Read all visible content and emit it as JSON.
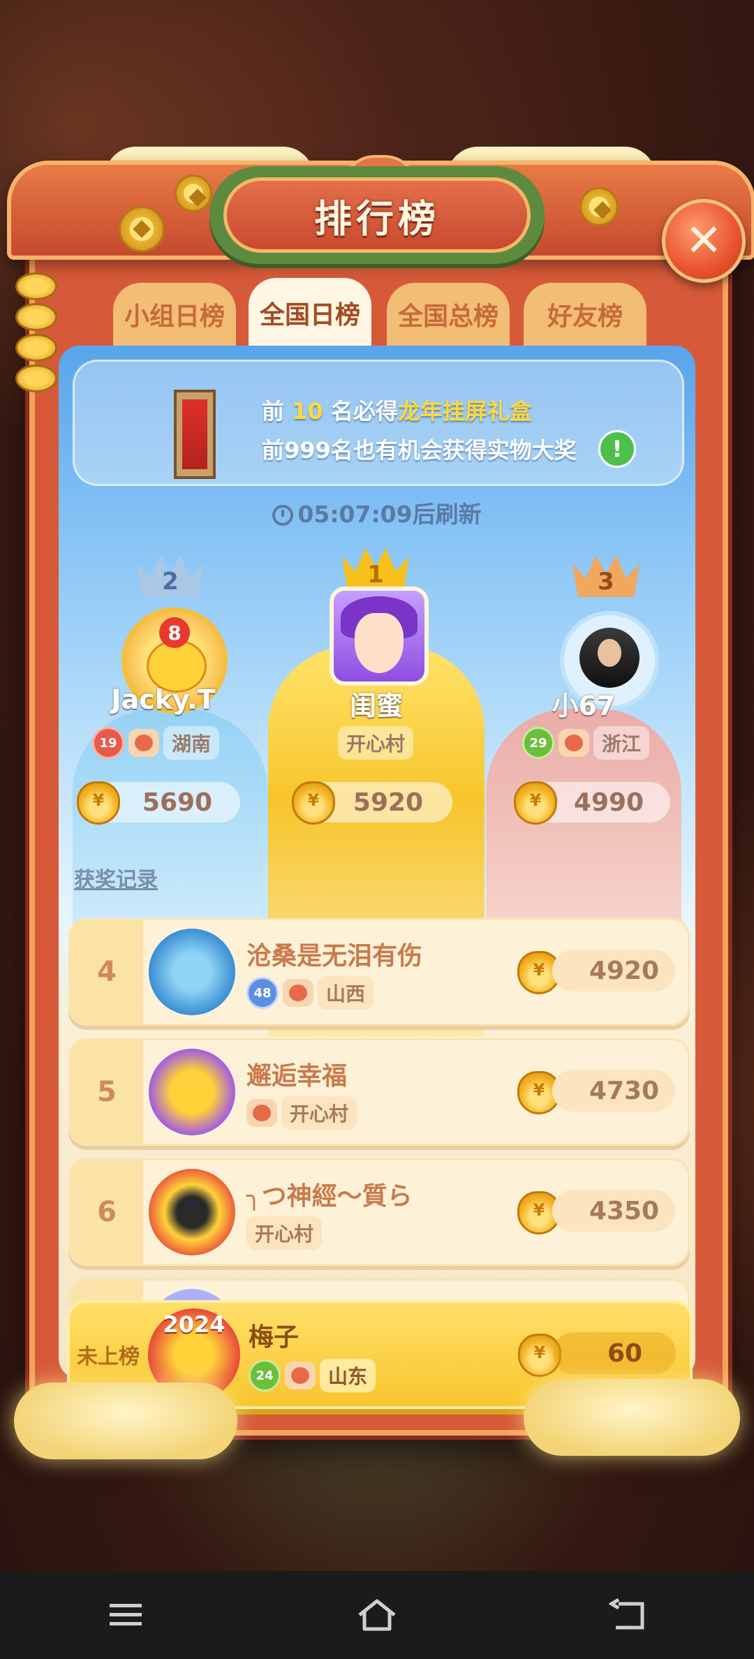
{
  "header": {
    "title": "排行榜"
  },
  "tabs": [
    {
      "label": "小组日榜",
      "active": false
    },
    {
      "label": "全国日榜",
      "active": true
    },
    {
      "label": "全国总榜",
      "active": false
    },
    {
      "label": "好友榜",
      "active": false
    }
  ],
  "banner": {
    "line1_prefix": "前 ",
    "line1_number": "10",
    "line1_mid": " 名必得",
    "line1_prize": "龙年挂屏礼盒",
    "line2": "前999名也有机会获得实物大奖"
  },
  "refresh": {
    "countdown": "05:07:09",
    "suffix": "后刷新"
  },
  "podium": {
    "first": {
      "rank": "1",
      "name": "闺蜜",
      "region": "开心村",
      "score": "5920"
    },
    "second": {
      "rank": "2",
      "name": "Jacky.T",
      "level": "19",
      "region": "湖南",
      "score": "5690",
      "avatar_badge": "8"
    },
    "third": {
      "rank": "3",
      "name": "小67",
      "level": "29",
      "region": "浙江",
      "score": "4990"
    }
  },
  "award_link": "获奖记录",
  "ranking": [
    {
      "rank": "4",
      "name": "沧桑是无泪有伤",
      "level": "48",
      "region": "山西",
      "score": "4920"
    },
    {
      "rank": "5",
      "name": "邂逅幸福",
      "region": "开心村",
      "score": "4730"
    },
    {
      "rank": "6",
      "name": "╮つ神經～質ら",
      "region": "开心村",
      "score": "4350"
    }
  ],
  "me": {
    "rank_label": "未上榜",
    "name": "梅子",
    "level": "24",
    "region": "山东",
    "score": "60",
    "avatar_badge": "2024"
  },
  "colors": {
    "frame": "#d65a3a",
    "accent_gold": "#f7c52c",
    "panel_blue": "#5aa4ea"
  },
  "icons": {
    "close": "close-icon",
    "coin_bag": "coin-bag-icon",
    "clock": "clock-icon",
    "info": "info-icon"
  }
}
